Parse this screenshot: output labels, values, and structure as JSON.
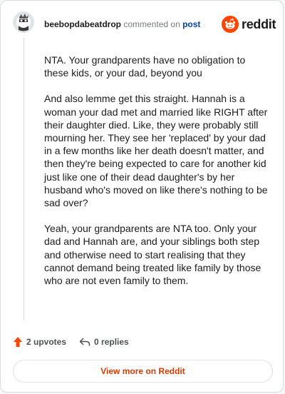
{
  "header": {
    "username": "beebopdabeatdrop",
    "action_text": "commented on",
    "post_link": "post",
    "brand": "reddit"
  },
  "comment": {
    "paragraphs": [
      "NTA. Your grandparents have no obligation to these kids, or your dad, beyond you",
      "And also lemme get this straight. Hannah is a woman your dad met and married like RIGHT after their daughter died. Like, they were probably still mourning her. They see her 'replaced' by your dad in a few months like her death doesn't matter, and then they're being expected to care for another kid just like one of their dead daughter's by her husband who's moved on like there's nothing to be sad over?",
      "Yeah, your grandparents are NTA too. Only your dad and Hannah are, and your siblings both step and otherwise need to start realising that they cannot demand being treated like family by those who are not even family to them."
    ]
  },
  "footer": {
    "upvotes": "2 upvotes",
    "replies": "0 replies",
    "view_more": "View more on Reddit"
  },
  "colors": {
    "brand_orange": "#ff4500",
    "upvote_orange": "#ff4500",
    "link_blue": "#0045ac",
    "view_more_text": "#d93a00"
  },
  "icons": {
    "avatar": "snoo-avatar-icon",
    "brand": "reddit-logo-icon",
    "upvote": "upvote-arrow-icon",
    "reply": "reply-arrow-icon"
  }
}
